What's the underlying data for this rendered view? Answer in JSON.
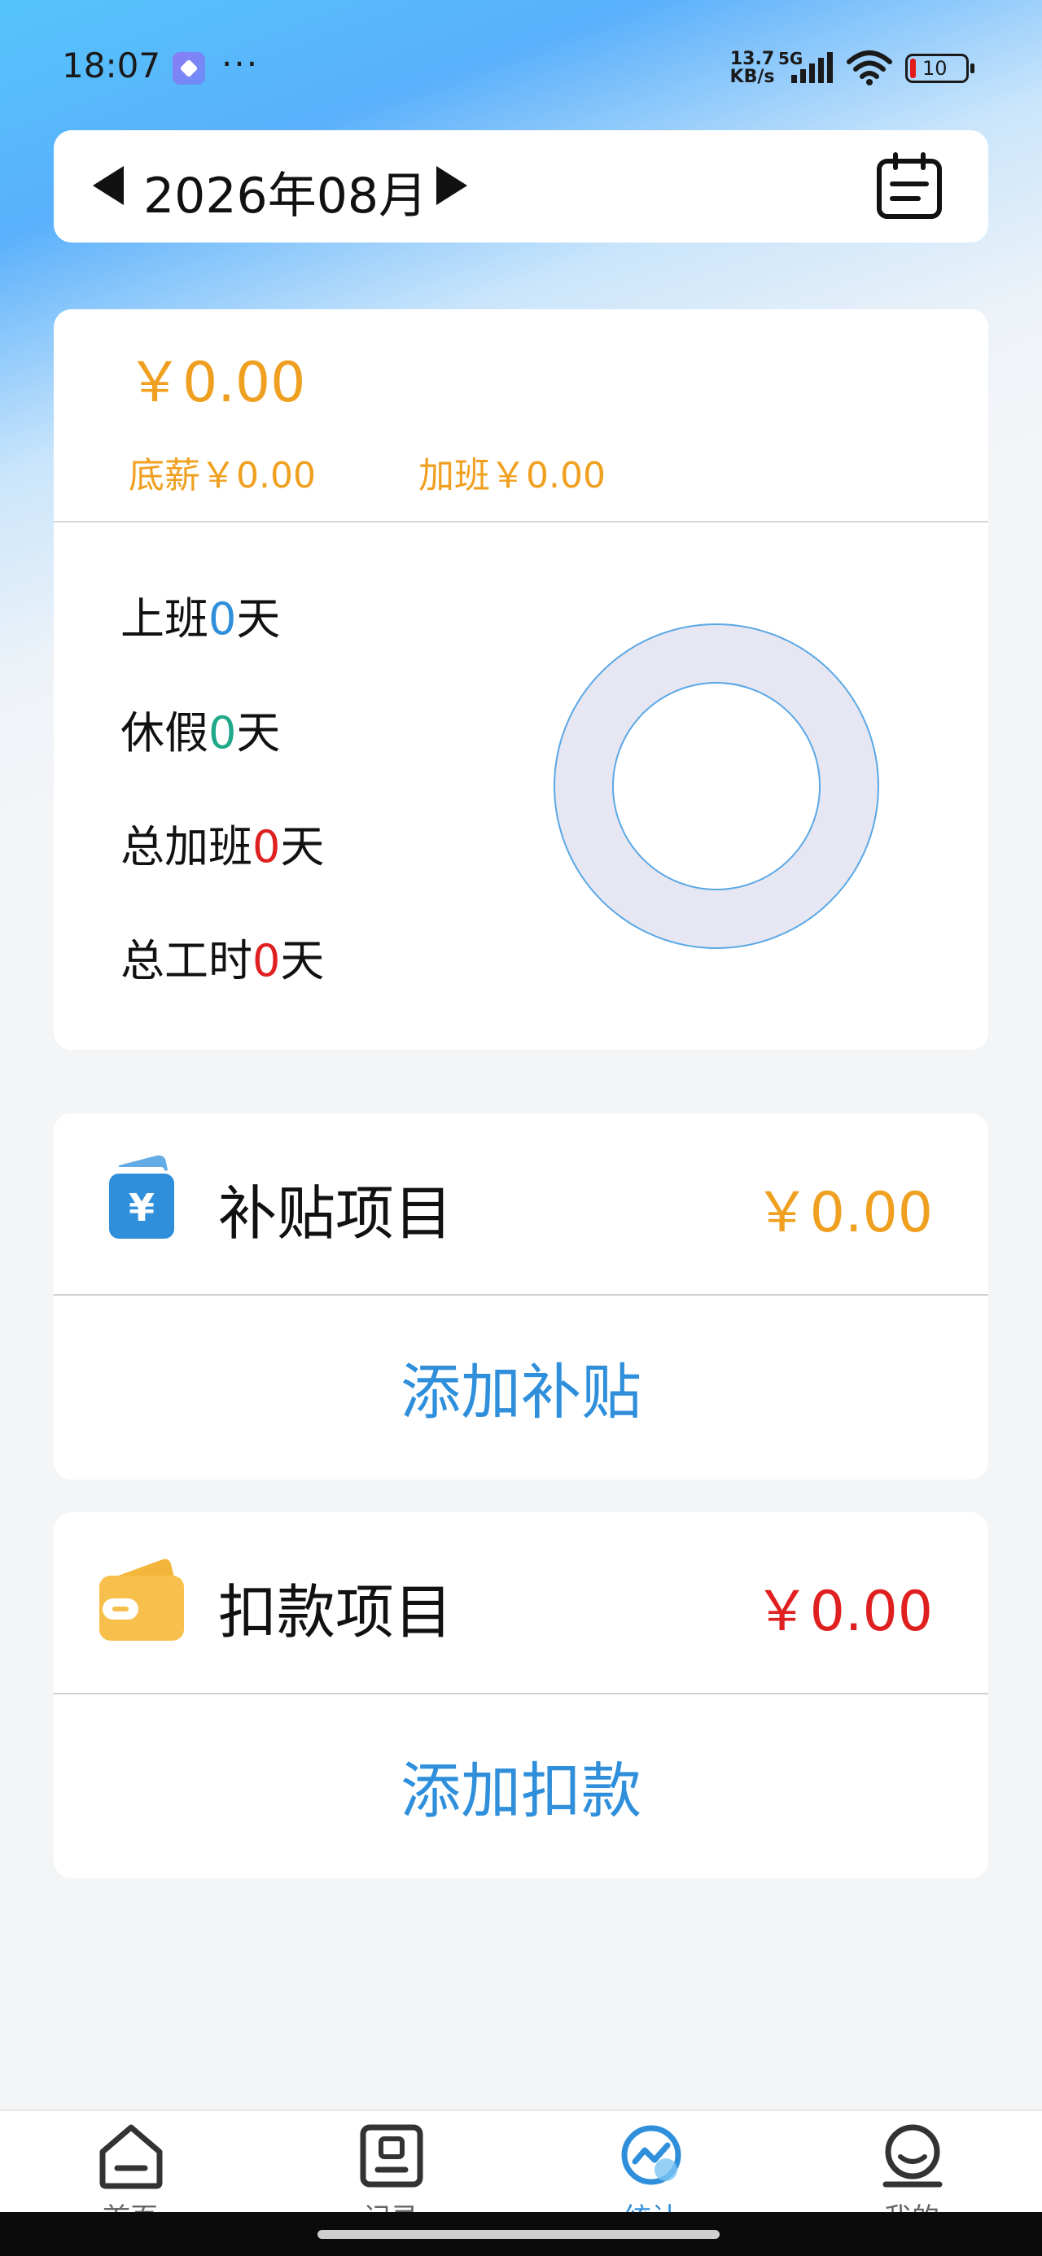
{
  "status_bar": {
    "time": "18:07",
    "more": "···",
    "net_speed_value": "13.7",
    "net_speed_unit": "KB/s",
    "network": "5G",
    "battery": "10"
  },
  "month_selector": {
    "label": "2026年08月"
  },
  "summary": {
    "total": "￥0.00",
    "base_salary": "底薪￥0.00",
    "overtime_pay": "加班￥0.00",
    "stats": [
      {
        "prefix": "上班",
        "value": "0",
        "suffix": "天"
      },
      {
        "prefix": "休假",
        "value": "0",
        "suffix": "天"
      },
      {
        "prefix": "总加班",
        "value": "0",
        "suffix": "天"
      },
      {
        "prefix": "总工时",
        "value": "0",
        "suffix": "天"
      }
    ]
  },
  "allowance": {
    "title": "补贴项目",
    "amount": "￥0.00",
    "action": "添加补贴"
  },
  "deduction": {
    "title": "扣款项目",
    "amount": "￥0.00",
    "action": "添加扣款"
  },
  "bottom_nav": [
    {
      "label": "首页",
      "icon": "home-icon"
    },
    {
      "label": "记录",
      "icon": "record-icon"
    },
    {
      "label": "统计",
      "icon": "stats-icon",
      "active": true
    },
    {
      "label": "我的",
      "icon": "profile-icon"
    }
  ],
  "colors": {
    "accent": "#2f8fdb",
    "amount": "#f0a020",
    "negative": "#e02020",
    "rest": "#20a88a"
  }
}
